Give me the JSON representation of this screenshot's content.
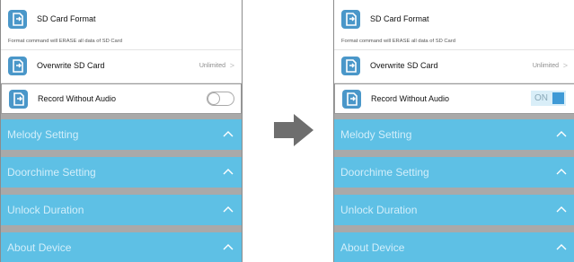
{
  "screens": [
    {
      "sd_card_format": {
        "title": "SD Card Format",
        "note": "Format command will ERASE all data of SD Card",
        "icon": "sd-card-icon"
      },
      "overwrite": {
        "title": "Overwrite SD Card",
        "value": "Unlimited",
        "chevron": ">",
        "icon": "sd-card-icon"
      },
      "record": {
        "title": "Record Without Audio",
        "toggle": "off",
        "icon": "sd-card-icon"
      },
      "sections": [
        {
          "label": "Melody Setting"
        },
        {
          "label": "Doorchime Setting"
        },
        {
          "label": "Unlock Duration"
        },
        {
          "label": "About Device"
        }
      ]
    },
    {
      "sd_card_format": {
        "title": "SD Card Format",
        "note": "Format command will ERASE all data of SD Card",
        "icon": "sd-card-icon"
      },
      "overwrite": {
        "title": "Overwrite SD Card",
        "value": "Unlimited",
        "chevron": ">",
        "icon": "sd-card-icon"
      },
      "record": {
        "title": "Record Without Audio",
        "toggle": "on",
        "toggle_label": "ON",
        "icon": "sd-card-icon"
      },
      "sections": [
        {
          "label": "Melody Setting"
        },
        {
          "label": "Doorchime Setting"
        },
        {
          "label": "Unlock Duration"
        },
        {
          "label": "About Device"
        }
      ]
    }
  ],
  "transition_arrow": "right-arrow-icon",
  "colors": {
    "accent_bar": "#5ec0e5",
    "icon_bg": "#4a97c9",
    "separator": "#a9a9a9",
    "toggle_on": "#3f9ad6"
  }
}
